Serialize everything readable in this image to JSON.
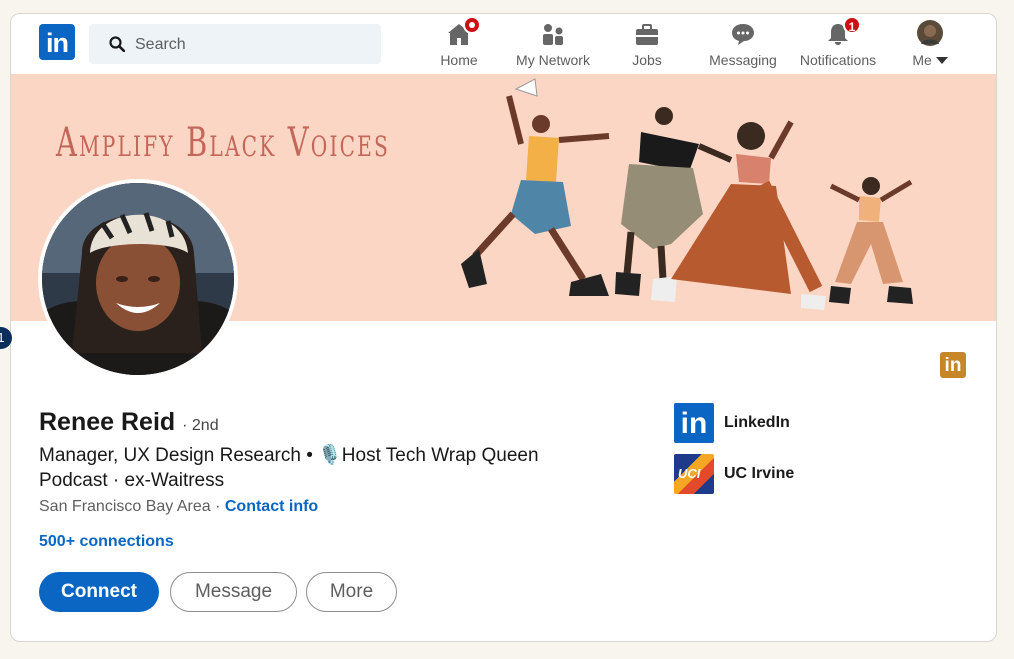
{
  "nav": {
    "logo_text": "in",
    "search_placeholder": "Search",
    "items": [
      {
        "label": "Home",
        "icon": "home-icon"
      },
      {
        "label": "My Network",
        "icon": "network-icon"
      },
      {
        "label": "Jobs",
        "icon": "briefcase-icon"
      },
      {
        "label": "Messaging",
        "icon": "message-icon"
      },
      {
        "label": "Notifications",
        "icon": "bell-icon",
        "badge": "1"
      },
      {
        "label": "Me",
        "icon": "avatar"
      }
    ]
  },
  "banner": {
    "text": "Amplify Black Voices"
  },
  "marker": "1",
  "profile": {
    "name": "Renee Reid",
    "degree": "· 2nd",
    "headline": "Manager, UX Design Research • 🎙️Host Tech Wrap Queen Podcast · ex-Waitress",
    "location": "San Francisco Bay Area ·",
    "contact_info": "Contact info",
    "connections": "500+ connections"
  },
  "buttons": {
    "connect": "Connect",
    "message": "Message",
    "more": "More"
  },
  "orgs": [
    {
      "name": "LinkedIn",
      "logo_text": "in"
    },
    {
      "name": "UC Irvine",
      "logo_text": "UCI"
    }
  ],
  "colors": {
    "brand": "#0a66c2",
    "banner_bg": "#fbd6c4",
    "banner_text": "#c4675b",
    "badge": "#cc1016"
  }
}
